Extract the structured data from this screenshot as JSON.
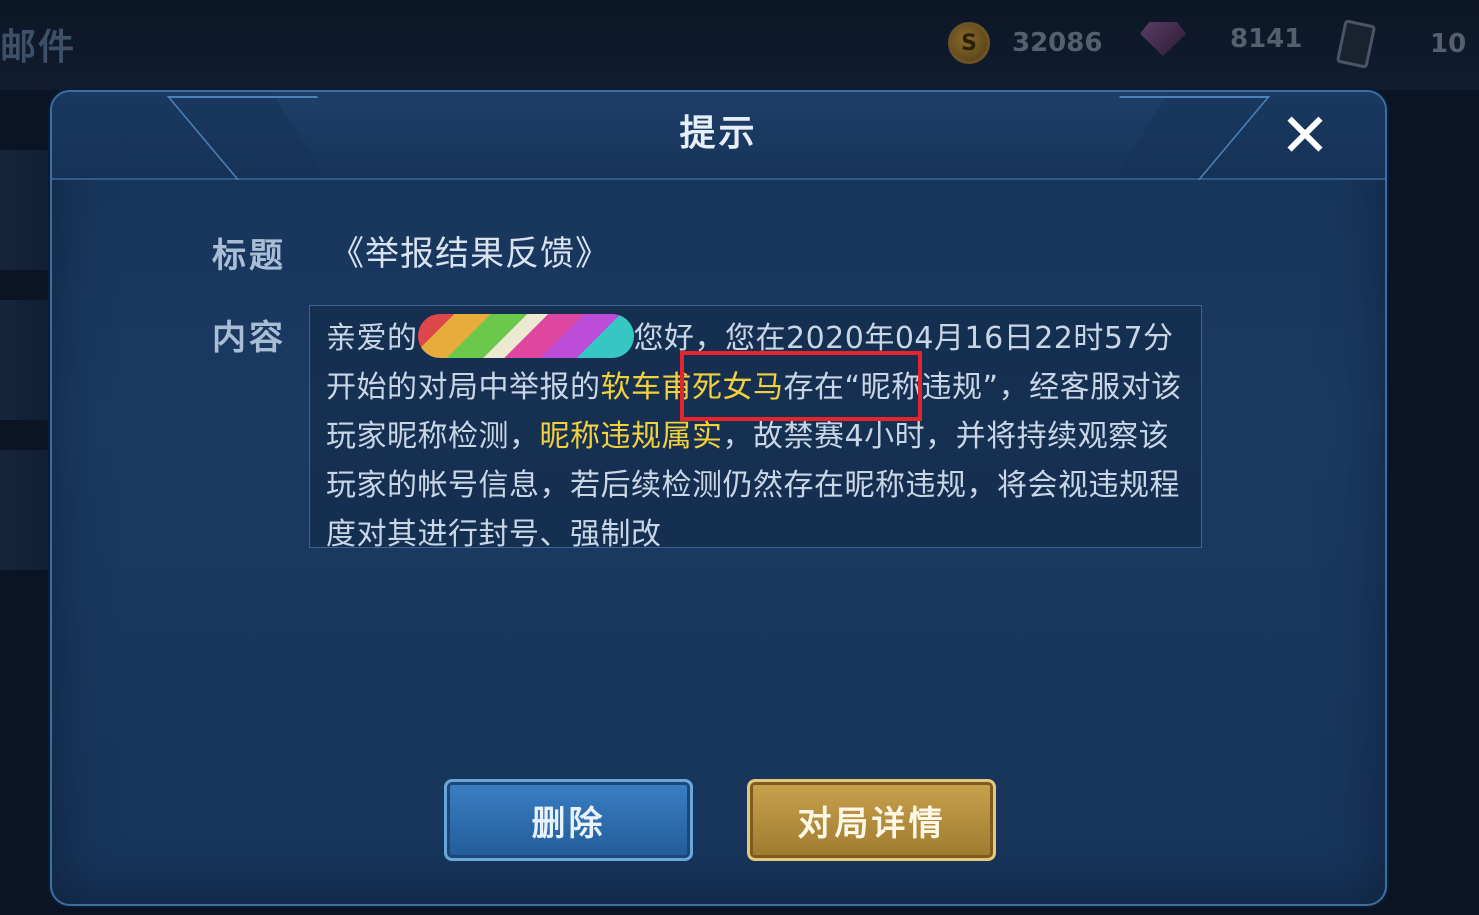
{
  "background": {
    "title_fragment": "邮件",
    "currencies": [
      {
        "icon": "gold-coin-icon",
        "value": "32086"
      },
      {
        "icon": "gem-icon",
        "value": "8141"
      },
      {
        "icon": "card-icon",
        "value": "10"
      }
    ]
  },
  "dialog": {
    "title": "提示",
    "close_icon": "✕",
    "subject_label": "标题",
    "subject_value": "《举报结果反馈》",
    "content_label": "内容",
    "content": {
      "greeting": "亲爱的",
      "after_name": "您好，您在2020年04月16日22时57分开始的对局中举报的",
      "highlight_name": "软车甫死女马",
      "after_highlight": "存在“昵称违规”，经客服对该玩家昵称检测，",
      "highlight_result": "昵称违规属实",
      "rest": "，故禁赛4小时，并将持续观察该玩家的帐号信息，若后续检测仍然存在昵称违规，将会视违规程度对其进行封号、强制改"
    },
    "buttons": {
      "delete": "删除",
      "match_details": "对局详情"
    }
  }
}
